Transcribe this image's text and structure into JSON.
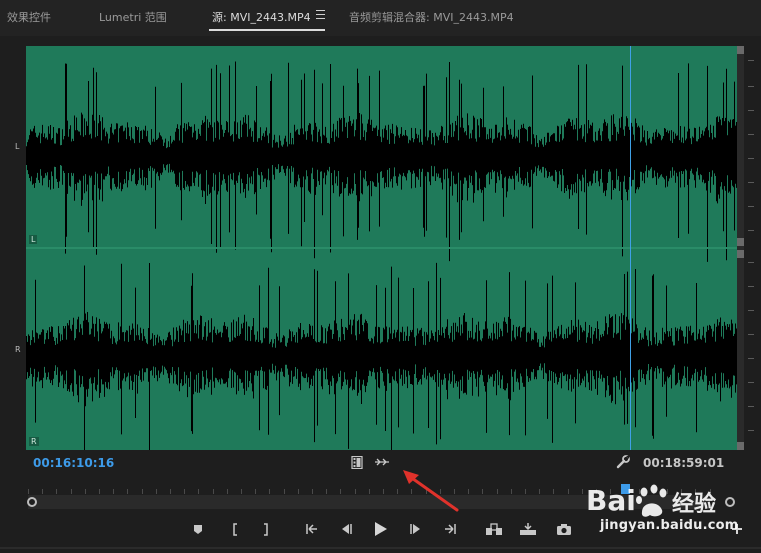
{
  "tabs": [
    {
      "label": "效果控件",
      "active": false
    },
    {
      "label": "Lumetri 范围",
      "active": false
    },
    {
      "label": "源: MVI_2443.MP4",
      "active": true
    },
    {
      "label": "音频剪辑混合器: MVI_2443.MP4",
      "active": false
    }
  ],
  "waveform": {
    "channels": [
      "L",
      "R"
    ],
    "background_color": "#1f7a5a",
    "wave_color": "#000000",
    "playhead_color": "#3fa0e6"
  },
  "timecode": {
    "current": "00:16:10:16",
    "duration": "00:18:59:01",
    "current_color": "#3d9be9"
  },
  "toolbar_icons": [
    "video-only-icon",
    "audio-only-icon",
    "settings-wrench-icon"
  ],
  "timeline": {
    "playhead_fraction": 0.87
  },
  "transport": [
    "add-marker-icon",
    "mark-in-icon",
    "mark-out-icon",
    "go-to-in-icon",
    "step-back-icon",
    "play-icon",
    "step-forward-icon",
    "go-to-out-icon",
    "insert-icon",
    "overwrite-icon",
    "export-frame-icon",
    "add-button-icon"
  ],
  "watermark": {
    "text": "Bai 经验",
    "url": "jingyan.baidu.com"
  }
}
